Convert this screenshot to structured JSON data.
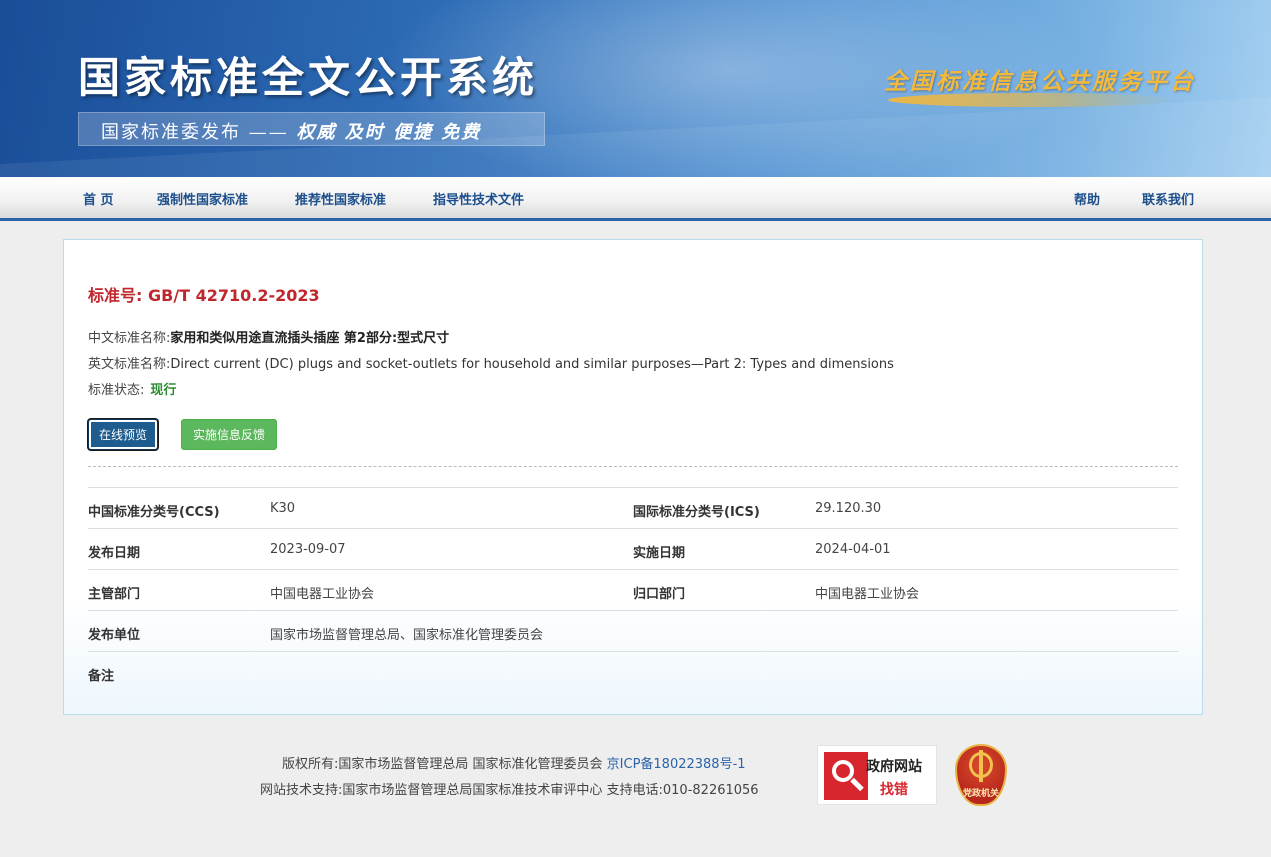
{
  "header": {
    "site_title": "国家标准全文公开系统",
    "tagline_prefix": "国家标准委发布 ——",
    "tagline_bold": "权威 及时 便捷 免费",
    "platform_name": "全国标准信息公共服务平台"
  },
  "nav": {
    "home": "首 页",
    "mandatory": "强制性国家标准",
    "recommended": "推荐性国家标准",
    "guidance": "指导性技术文件",
    "help": "帮助",
    "contact": "联系我们"
  },
  "standard": {
    "number_label": "标准号:",
    "number": "GB/T 42710.2-2023",
    "cn_name_label": "中文标准名称:",
    "cn_name": "家用和类似用途直流插头插座 第2部分:型式尺寸",
    "en_name_label": "英文标准名称:",
    "en_name": "Direct current (DC) plugs and socket-outlets for household and similar purposes—Part 2: Types and dimensions",
    "status_label": "标准状态:",
    "status": "现行",
    "status_color": "#2f8c36",
    "number_color": "#c0272d"
  },
  "buttons": {
    "preview": "在线预览",
    "feedback": "实施信息反馈"
  },
  "details": {
    "ccs_label": "中国标准分类号(CCS)",
    "ccs_value": "K30",
    "ics_label": "国际标准分类号(ICS)",
    "ics_value": "29.120.30",
    "publish_date_label": "发布日期",
    "publish_date": "2023-09-07",
    "implement_date_label": "实施日期",
    "implement_date": "2024-04-01",
    "competent_dept_label": "主管部门",
    "competent_dept": "中国电器工业协会",
    "central_dept_label": "归口部门",
    "central_dept": "中国电器工业协会",
    "issuer_label": "发布单位",
    "issuer": "国家市场监督管理总局、国家标准化管理委员会",
    "remarks_label": "备注",
    "remarks": ""
  },
  "footer": {
    "copyright": "版权所有:国家市场监督管理总局 国家标准化管理委员会",
    "icp": "京ICP备18022388号-1",
    "support": "网站技术支持:国家市场监督管理总局国家标准技术审评中心 支持电话:010-82261056",
    "gov_badge_line1": "政府网站",
    "gov_badge_line2": "找错",
    "party_badge": "党政机关"
  },
  "colors": {
    "brand_blue": "#2b64a8",
    "nav_text": "#1d4f8c",
    "feedback_green": "#5cb85c",
    "preview_blue": "#1e5b8f"
  }
}
